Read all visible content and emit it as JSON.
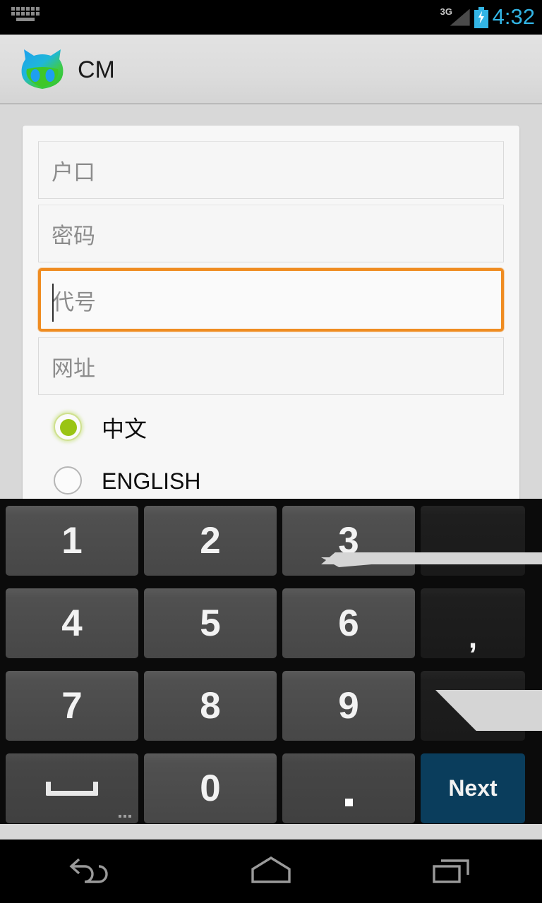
{
  "status_bar": {
    "ime_icon": "keyboard-icon",
    "network_label": "3G",
    "signal_icon": "signal-triangle-icon",
    "battery_icon": "battery-charging-icon",
    "clock": "4:32",
    "clock_color": "#33b5e5",
    "background": "#000000"
  },
  "action_bar": {
    "logo_icon": "cyanogenmod-cat-logo",
    "title": "CM",
    "background": "#dcdcdc",
    "logo_colors": {
      "top": "#1e9ff0",
      "bottom": "#2ecc2e"
    }
  },
  "form": {
    "fields": [
      {
        "name": "account",
        "placeholder": "户口",
        "value": "",
        "focused": false
      },
      {
        "name": "password",
        "placeholder": "密码",
        "value": "",
        "focused": false
      },
      {
        "name": "code",
        "placeholder": "代号",
        "value": "",
        "focused": true
      },
      {
        "name": "url",
        "placeholder": "网址",
        "value": "",
        "focused": false
      }
    ],
    "focus_color": "#ef8c21",
    "language_options": [
      {
        "label": "中文",
        "selected": true
      },
      {
        "label": "ENGLISH",
        "selected": false
      }
    ],
    "radio_selected_color": "#9ac413"
  },
  "keyboard": {
    "type": "numeric",
    "rows": [
      [
        {
          "label": "1",
          "style": "num"
        },
        {
          "label": "2",
          "style": "num"
        },
        {
          "label": "3",
          "style": "num"
        },
        {
          "label": "",
          "style": "side",
          "icon": "blank-key"
        }
      ],
      [
        {
          "label": "4",
          "style": "num"
        },
        {
          "label": "5",
          "style": "num"
        },
        {
          "label": "6",
          "style": "num"
        },
        {
          "label": ",",
          "style": "side"
        }
      ],
      [
        {
          "label": "7",
          "style": "num"
        },
        {
          "label": "8",
          "style": "num"
        },
        {
          "label": "9",
          "style": "num"
        },
        {
          "label": "",
          "style": "side",
          "icon": "blank-key"
        }
      ],
      [
        {
          "label": "",
          "style": "space",
          "icon": "space-bar-icon"
        },
        {
          "label": "0",
          "style": "num"
        },
        {
          "label": "",
          "style": "period",
          "icon": "period-dot-icon"
        },
        {
          "label": "Next",
          "style": "enter"
        }
      ]
    ],
    "enter_label": "Next",
    "enter_color": "#0a3d5c",
    "key_color": "#474747",
    "side_key_color": "#1a1a1a",
    "background": "#0b0b0b",
    "gesture_trail_color": "#d5d5d5"
  },
  "nav_bar": {
    "buttons": [
      {
        "name": "back",
        "icon": "back-arrow-icon"
      },
      {
        "name": "home",
        "icon": "home-icon"
      },
      {
        "name": "recents",
        "icon": "recents-icon"
      }
    ],
    "background": "#000000"
  }
}
